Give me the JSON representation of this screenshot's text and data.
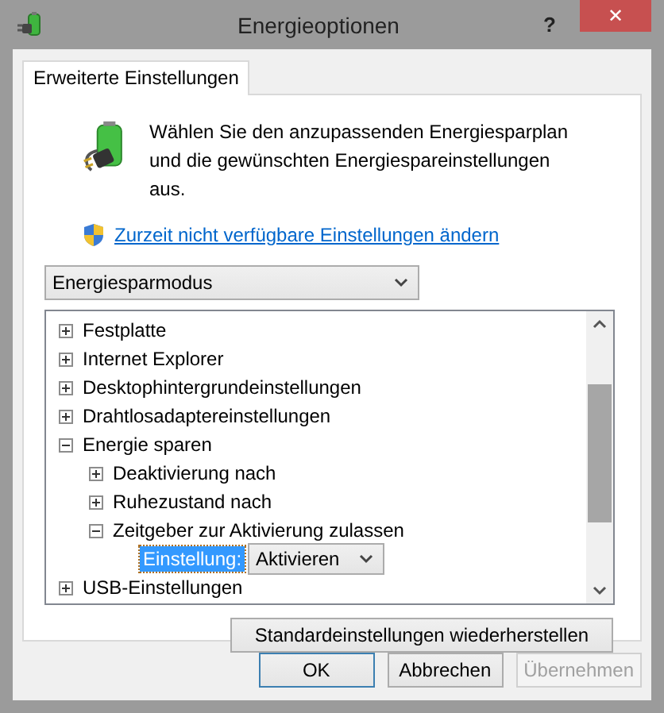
{
  "window": {
    "title": "Energieoptionen",
    "help": "?",
    "close": "✕"
  },
  "tabs": [
    {
      "label": "Erweiterte Einstellungen",
      "selected": true
    }
  ],
  "intro": "Wählen Sie den anzupassenden Energiesparplan und die gewünschten Energiespareinstellungen aus.",
  "link": "Zurzeit nicht verfügbare Einstellungen ändern",
  "plan_dropdown": {
    "value": "Energiesparmodus"
  },
  "tree": [
    {
      "label": "Festplatte",
      "expanded": false
    },
    {
      "label": "Internet Explorer",
      "expanded": false
    },
    {
      "label": "Desktophintergrundeinstellungen",
      "expanded": false
    },
    {
      "label": "Drahtlosadaptereinstellungen",
      "expanded": false
    },
    {
      "label": "Energie sparen",
      "expanded": true,
      "children": [
        {
          "label": "Deaktivierung nach",
          "expanded": false
        },
        {
          "label": "Ruhezustand nach",
          "expanded": false
        },
        {
          "label": "Zeitgeber zur Aktivierung zulassen",
          "expanded": true,
          "children": [
            {
              "kind": "setting",
              "label": "Einstellung:",
              "value": "Aktivieren",
              "selected": true
            }
          ]
        }
      ]
    },
    {
      "label": "USB-Einstellungen",
      "expanded": false
    }
  ],
  "restore_button": "Standardeinstellungen wiederherstellen",
  "buttons": [
    {
      "label": "OK",
      "disabled": false,
      "focused": true
    },
    {
      "label": "Abbrechen",
      "disabled": false,
      "focused": false
    },
    {
      "label": "Übernehmen",
      "disabled": true,
      "focused": false
    }
  ]
}
